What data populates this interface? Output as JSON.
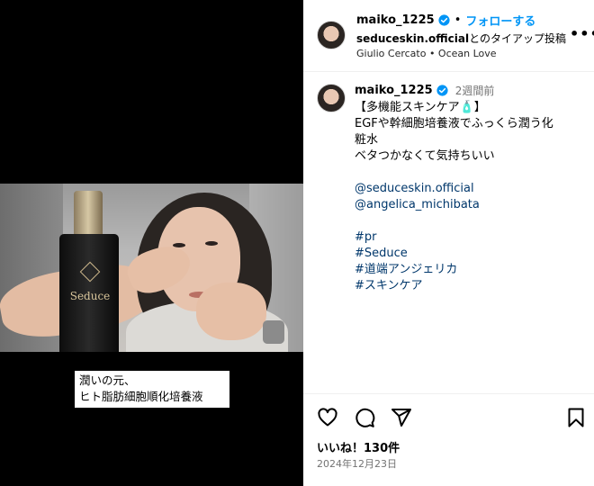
{
  "post": {
    "video_caption": {
      "line1": "潤いの元、",
      "line2": "ヒト脂肪細胞順化培養液"
    },
    "bottle_brand": "Seduce"
  },
  "header": {
    "username": "maiko_1225",
    "separator": "•",
    "follow_label": "フォローする",
    "partner_account": "seduceskin.official",
    "partner_suffix": "とのタイアップ投稿",
    "audio": "Giulio Cercato • Ocean Love",
    "more_label": "•••"
  },
  "comment": {
    "username": "maiko_1225",
    "time": "2週間前",
    "lines": [
      "【多機能スキンケア🧴】",
      "EGFや幹細胞培養液でふっくら潤う化",
      "粧水",
      "ベタつかなくて気持ちいい",
      "",
      "@seduceskin.official",
      "@angelica_michibata",
      "",
      "#pr",
      "#Seduce",
      "#道端アンジェリカ",
      "#スキンケア"
    ]
  },
  "footer": {
    "likes": "いいね！130件",
    "date": "2024年12月23日"
  },
  "icons": [
    "verified-badge-icon",
    "heart-icon",
    "comment-icon",
    "share-icon",
    "bookmark-icon",
    "more-options-icon"
  ],
  "colors": {
    "accent": "#0095f6",
    "verified": "#0095f6",
    "link": "#00376b",
    "muted": "#737373"
  }
}
